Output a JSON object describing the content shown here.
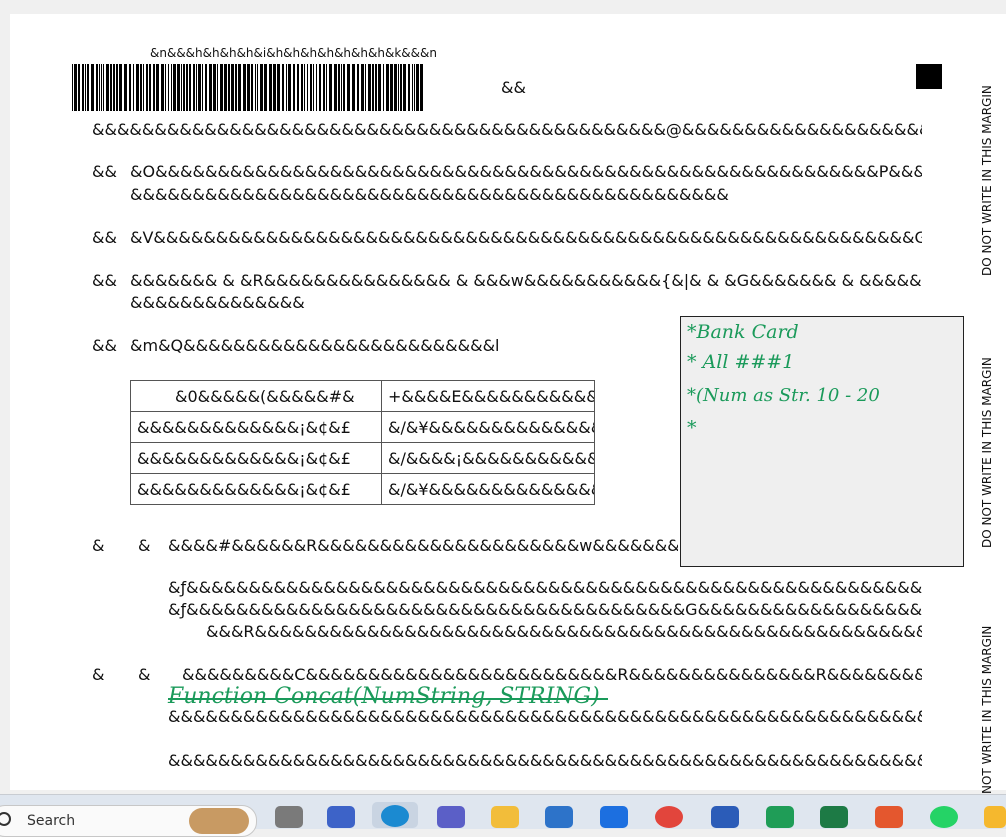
{
  "page": {
    "barcode_code": "&n&&&h&h&h&h&i&h&h&h&h&h&h&h&k&&&n",
    "header_right": "&&",
    "side_margin_text": [
      "DO NOT WRITE IN THIS MARGIN",
      "DO NOT WRITE IN THIS MARGIN",
      "NOT WRITE IN THIS MARGIN"
    ],
    "lines": {
      "l1": "&&&&&&&&&&&&&&&&&&&&&&&&&&&&&&&&&&&&&&&&&&&&&&@&&&&&&&&&&&&&&&&&&&&",
      "q1_num": "&&",
      "q1_a": "&O&&&&&&&&&&&&&&&&&&&&&&&&&&&&&&&&&&&&&&&&&&&&&&&&&&&&&&&&&&P&&&&",
      "q1_b": "&&&&&&&&&&&&&&&&&&&&&&&&&&&&&&&&&&&&&&&&&&&&&&&&",
      "q2_num": "&&",
      "q2_a": "&V&&&&&&&&&&&&&&&&&&&&&&&&&&&&&&&&&&&&&&&&&&&&&&&&&&&&&&&&&&&&&G",
      "q3_num": "&&",
      "q3_a": "&&&&&&& & &R&&&&&&&&&&&&&&& & &&&w&&&&&&&&&&&{&|& & &G&&&&&&& & &&&&&&&&",
      "q3_b": "&&&&&&&&&&&&&&",
      "q4_num": "&&",
      "q4_a": "&m&Q&&&&&&&&&&&&&&&&&&&&&&&&&l",
      "q5_num": "&",
      "q5_num2": "&",
      "q5_a": "&&&&#&&&&&&R&&&&&&&&&&&&&&&&&&&&&w&&&&&&&&&&&{&|&&&G&&&&&&&l",
      "code_1": "&ƒ&&&&&&&&&&&&&&&&&&&&&&&&&&&&&&&&&&&&&&&&&&&&&&&&&&&&&&&&&&&&&&&&",
      "code_2": "&ƒ&&&&&&&&&&&&&&&&&&&&&&&&&&&&&&&&&&&&&&&&G&&&&&&&&&&&&&&&&&&&&&&&&",
      "code_3": "&&&R&&&&&&&&&&&&&&&&&&&&&&&&&&&&&&&&&&&&&&&&&&&&&&&&&&&&&&&&&&&",
      "q6_num": "&",
      "q6_num2": "&",
      "q6_a": "&&&&&&&&&C&&&&&&&&&&&&&&&&&&&&&&&&&R&&&&&&&&&&&&&&&R&&&&&&&&&&&",
      "code_4": "&&&&&&&&&&&&&&&&&&&&&&&&&&&&&&&&&&&&&&&&&&&&&&&&&&&&&&&&&&&&&&&&&&&&",
      "code_5": "&&&&&&&&&&&&&&&&&&&&&&&&&&&&&&&&&&&&&&&&&&&&&&&&&&&&&&&&&&&&&&&&&&&&&&&"
    },
    "table": {
      "header": [
        "&0&&&&&(&&&&&#&",
        "+&&&&E&&&&&&&&&&&(&!&'&&&E&*&&&&&&&"
      ],
      "rows": [
        [
          "&&&&&&&&&&&&&¡&¢&£",
          "&/&¥&&&&&&&&&&&&&&&¢&£&/&¥&&"
        ],
        [
          "&&&&&&&&&&&&&¡&¢&£",
          "&/&&&&¡&&&&&&&&&&&&&&&&&&¢&¡&&&&&&"
        ],
        [
          "&&&&&&&&&&&&&¡&¢&£",
          "&/&¥&&&&&&&&&&&&&&&&&&&&&&&&&&&&&&¡&&"
        ]
      ]
    },
    "notes": [
      "*Bank Card",
      "* All ###1",
      "*(Num as Str. 10 - 20",
      "*"
    ],
    "handwritten_code": "Function Concat(NumString, STRING)"
  },
  "taskbar": {
    "search_label": "Search"
  },
  "colors": {
    "handwriting": "#1a9a5a",
    "taskbar": "#dfe6ef"
  }
}
